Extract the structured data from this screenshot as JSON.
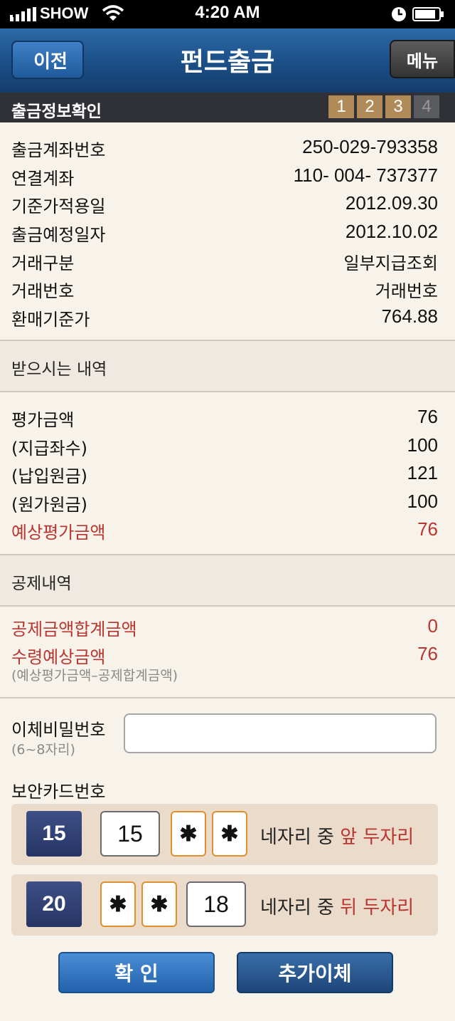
{
  "status_bar": {
    "carrier": "SHOW",
    "time": "4:20 AM"
  },
  "nav": {
    "back_label": "이전",
    "title": "펀드출금",
    "menu_label": "메뉴"
  },
  "section_bar": {
    "title": "출금정보확인",
    "steps": [
      "1",
      "2",
      "3",
      "4"
    ],
    "current_step": 3
  },
  "info": [
    {
      "label": "출금계좌번호",
      "value": "250-029-793358"
    },
    {
      "label": "연결계좌",
      "value": "110- 004- 737377"
    },
    {
      "label": "기준가적용일",
      "value": "2012.09.30"
    },
    {
      "label": "출금예정일자",
      "value": "2012.10.02"
    },
    {
      "label": "거래구분",
      "value": "일부지급조회"
    },
    {
      "label": "거래번호",
      "value": "거래번호"
    },
    {
      "label": "환매기준가",
      "value": "764.88"
    }
  ],
  "receive": {
    "title": "받으시는 내역",
    "rows": [
      {
        "label": "평가금액",
        "value": "76"
      },
      {
        "label": "(지급좌수)",
        "value": "100"
      },
      {
        "label": "(납입원금)",
        "value": "121"
      },
      {
        "label": "(원가원금)",
        "value": "100"
      },
      {
        "label": "예상평가금액",
        "value": "76"
      }
    ]
  },
  "deduction": {
    "title": "공제내역",
    "rows": [
      {
        "label": "공제금액합계금액",
        "value": "0"
      },
      {
        "label": "수령예상금액",
        "value": "76"
      }
    ],
    "note": "(예상평가금액–공제합계금액)"
  },
  "password": {
    "label": "이체비밀번호",
    "sub": "(6~8자리)",
    "value": ""
  },
  "security_card": {
    "label": "보안카드번호",
    "row1": {
      "number": "15",
      "digit1": "15",
      "mask1": "✱",
      "mask2": "✱",
      "text": "네자리 중",
      "highlight": "앞 두자리"
    },
    "row2": {
      "number": "20",
      "mask1": "✱",
      "mask2": "✱",
      "digit": "18",
      "text": "네자리 중",
      "highlight": "뒤 두자리"
    }
  },
  "buttons": {
    "confirm": "확 인",
    "extra": "추가이체"
  },
  "colors": {
    "accent_red": "#b8362f",
    "nav_blue": "#1b4e86",
    "step_active": "#b08a57",
    "mask_border": "#e0902a"
  }
}
